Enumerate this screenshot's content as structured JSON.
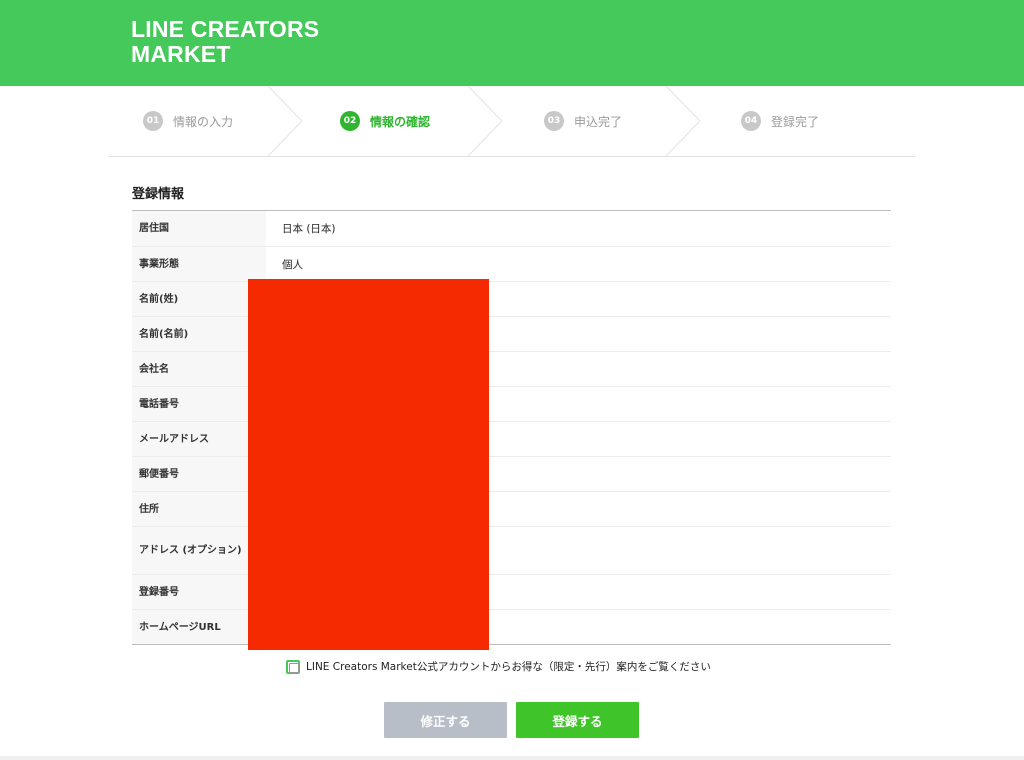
{
  "header": {
    "logo_line1": "LINE CREATORS",
    "logo_line2": "MARKET",
    "bg_color": "#44c95a"
  },
  "steps": [
    {
      "num": "01",
      "label": "情報の入力",
      "active": false
    },
    {
      "num": "02",
      "label": "情報の確認",
      "active": true
    },
    {
      "num": "03",
      "label": "申込完了",
      "active": false
    },
    {
      "num": "04",
      "label": "登録完了",
      "active": false
    }
  ],
  "section": {
    "title": "登録情報"
  },
  "registration": {
    "rows": [
      {
        "label": "居住国",
        "value": "日本 (日本)"
      },
      {
        "label": "事業形態",
        "value": "個人"
      },
      {
        "label": "名前(姓)",
        "value": ""
      },
      {
        "label": "名前(名前)",
        "value": ""
      },
      {
        "label": "会社名",
        "value": ""
      },
      {
        "label": "電話番号",
        "value": ""
      },
      {
        "label": "メールアドレス",
        "value": ""
      },
      {
        "label": "郵便番号",
        "value": ""
      },
      {
        "label": "住所",
        "value": ""
      },
      {
        "label": "アドレス (オプション)",
        "value": ""
      },
      {
        "label": "登録番号",
        "value": ""
      },
      {
        "label": "ホームページURL",
        "value": ""
      }
    ]
  },
  "consent": {
    "label": "LINE Creators Market公式アカウントからお得な（限定・先行）案内をご覧ください",
    "checked": false
  },
  "buttons": {
    "edit_label": "修正する",
    "submit_label": "登録する"
  },
  "colors": {
    "accent_green": "#2fb52f",
    "button_green": "#3fc42a",
    "button_gray": "#b8bec8",
    "redaction": "#f52a00"
  }
}
